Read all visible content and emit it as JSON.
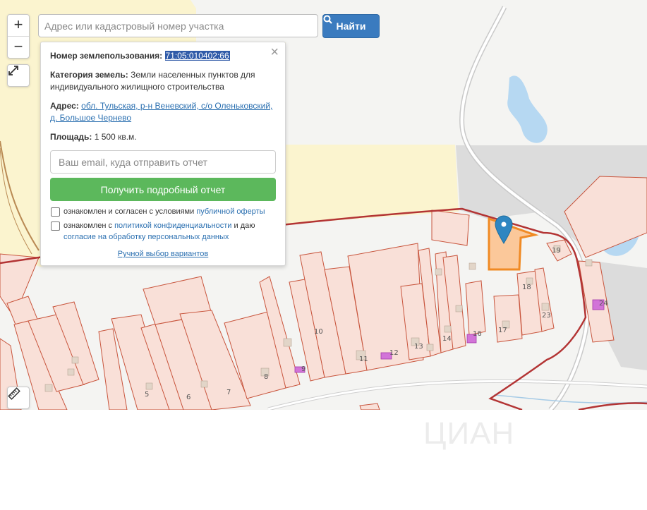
{
  "colors": {
    "parcel_fill": "#f9e0d8",
    "parcel_stroke": "#c8553d",
    "selected_fill": "#fbc89a",
    "selected_stroke": "#f08a24",
    "marker": "#2e86c1",
    "boundary": "#b33434",
    "water": "#b6d8f2",
    "yellow_zone": "#fbf4cf",
    "gray_zone": "#dcdcdc",
    "building": "#d9c7b8",
    "purple": "#d274d8",
    "find_button": "#3a7bbf",
    "report_button": "#5cb85c"
  },
  "map": {
    "zoom_in": "+",
    "zoom_out": "−",
    "fullscreen_icon": "expand-icon",
    "ruler_icon": "ruler-icon",
    "search_placeholder": "Адрес или кадастровый номер участка",
    "find_label": "Найти",
    "parcel_numbers": [
      "5",
      "6",
      "7",
      "8",
      "9",
      "10",
      "11",
      "12",
      "13",
      "14",
      "16",
      "17",
      "18",
      "19",
      "23",
      "24"
    ]
  },
  "popup": {
    "number_label": "Номер землепользования:",
    "number_value": "71:05:010402:66",
    "category_label": "Категория земель:",
    "category_value": "Земли населенных пунктов для индивидуального жилищного строительства",
    "address_label": "Адрес:",
    "address_value": "обл. Тульская, р-н Веневский, с/о Оленьковский, д. Большое Чернево",
    "area_label": "Площадь:",
    "area_value": "1 500 кв.м.",
    "email_placeholder": "Ваш email, куда отправить отчет",
    "report_button": "Получить подробный отчет",
    "check1_text": "ознакомлен и согласен с условиями",
    "check1_link": "публичной оферты",
    "check2_text": "ознакомлен с",
    "check2_link": "политикой конфиденциальности",
    "check2_mid": "и даю",
    "check2_link2": "согласие на обработку персональных данных",
    "manual_link": "Ручной выбор вариантов",
    "close": "×"
  },
  "watermark": "ЦИАН"
}
